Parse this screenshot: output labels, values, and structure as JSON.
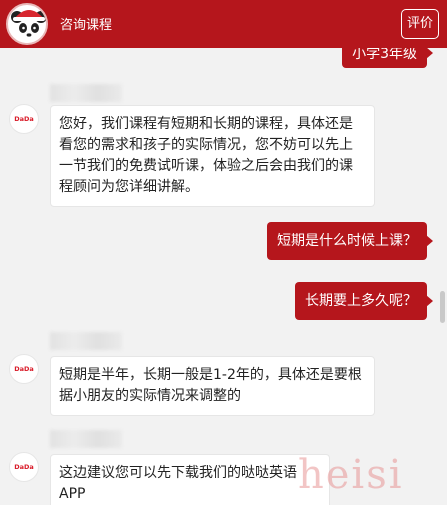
{
  "header": {
    "title": "咨询课程",
    "rate_button": "评价"
  },
  "agent_logo_text": "DaDa",
  "messages": [
    {
      "side": "right",
      "text": "小学3年级"
    },
    {
      "side": "left",
      "text": "您好，我们课程有短期和长期的课程，具体还是看您的需求和孩子的实际情况，您不妨可以先上一节我们的免费试听课，体验之后会由我们的课程顾问为您详细讲解。"
    },
    {
      "side": "right",
      "text": "短期是什么时候上课？"
    },
    {
      "side": "right",
      "text": "长期要上多久呢？"
    },
    {
      "side": "left",
      "text": "短期是半年，长期一般是1-2年的，具体还是要根据小朋友的实际情况来调整的"
    },
    {
      "side": "left",
      "text": "这边建议您可以先下载我们的哒哒英语APP"
    }
  ],
  "watermark": "heisi",
  "colors": {
    "brand": "#b5161c",
    "bubble_left": "#ffffff",
    "background": "#f2f2f2"
  }
}
